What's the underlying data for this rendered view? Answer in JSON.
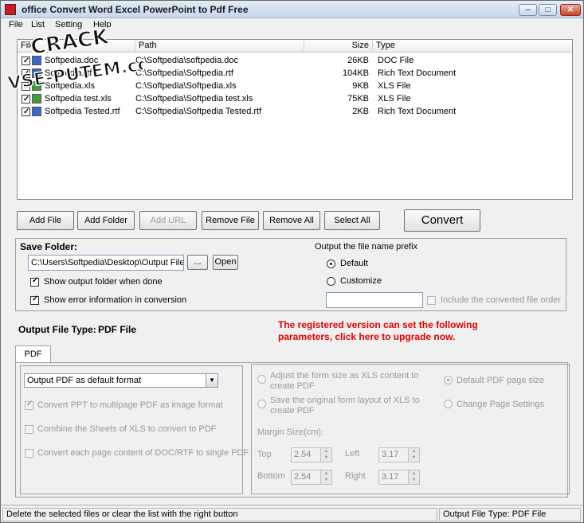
{
  "window": {
    "title": "office Convert Word Excel PowerPoint to Pdf Free",
    "min_label": "–",
    "max_label": "□",
    "close_label": "✕"
  },
  "menu": [
    "File",
    "List",
    "Setting",
    "Help"
  ],
  "file_list": {
    "columns": {
      "name": "File",
      "path": "Path",
      "size": "Size",
      "type": "Type"
    },
    "rows": [
      {
        "checked": true,
        "icon": "doc",
        "name": "Softpedia.doc",
        "path": "C:\\Softpedia\\softpedia.doc",
        "size": "26KB",
        "type": "DOC File"
      },
      {
        "checked": true,
        "icon": "rtf",
        "name": "Softpedia.rtf",
        "path": "C:\\Softpedia\\Softpedia.rtf",
        "size": "104KB",
        "type": "Rich Text Document"
      },
      {
        "checked": true,
        "icon": "xls",
        "name": "Softpedia.xls",
        "path": "C:\\Softpedia\\Softpedia.xls",
        "size": "9KB",
        "type": "XLS File"
      },
      {
        "checked": true,
        "icon": "xls",
        "name": "Softpedia test.xls",
        "path": "C:\\Softpedia\\Softpedia test.xls",
        "size": "75KB",
        "type": "XLS File"
      },
      {
        "checked": true,
        "icon": "rtf",
        "name": "Softpedia Tested.rtf",
        "path": "C:\\Softpedia\\Softpedia Tested.rtf",
        "size": "2KB",
        "type": "Rich Text Document"
      }
    ]
  },
  "toolbar": {
    "add_file": "Add File",
    "add_folder": "Add Folder",
    "add_url": "Add URL",
    "remove_file": "Remove File",
    "remove_all": "Remove All",
    "select_all": "Select All",
    "convert": "Convert"
  },
  "save_folder": {
    "label": "Save Folder:",
    "path": "C:\\Users\\Softpedia\\Desktop\\Output Files",
    "browse": "...",
    "open": "Open",
    "show_output_folder": "Show output folder when done",
    "show_error_info": "Show error information in conversion",
    "prefix_title": "Output the file name prefix",
    "default": "Default",
    "customize": "Customize",
    "prefix_value": "",
    "include_order": "Include the converted file order"
  },
  "output_type": {
    "label": "Output File Type:",
    "value": "PDF File"
  },
  "upgrade": {
    "line1": "The registered version can set the following",
    "line2": "parameters, click here to upgrade now."
  },
  "pdf_tab": {
    "tab_label": "PDF",
    "format_combo": "Output PDF as default format",
    "convert_ppt": "Convert PPT to multipage PDF as image format",
    "combine_sheets": "Combine the Sheets of XLS to convert to PDF",
    "convert_each_page": "Convert each page content of DOC/RTF to single PDF"
  },
  "advanced": {
    "adjust_form_line1": "Adjust the form size as XLS content to",
    "adjust_form_line2": "create PDF",
    "save_layout_line1": "Save the original form layout of XLS to",
    "save_layout_line2": "create PDF",
    "default_page_size": "Default PDF page size",
    "change_page_settings": "Change Page Settings",
    "margin_title": "Margin Size(cm):",
    "top_label": "Top",
    "top_value": "2.54",
    "left_label": "Left",
    "left_value": "3.17",
    "bottom_label": "Bottom",
    "bottom_value": "2.54",
    "right_label": "Right",
    "right_value": "3.17"
  },
  "status": {
    "hint": "Delete the selected files or clear the list with the right button",
    "output_type": "Output File Type:  PDF File"
  }
}
